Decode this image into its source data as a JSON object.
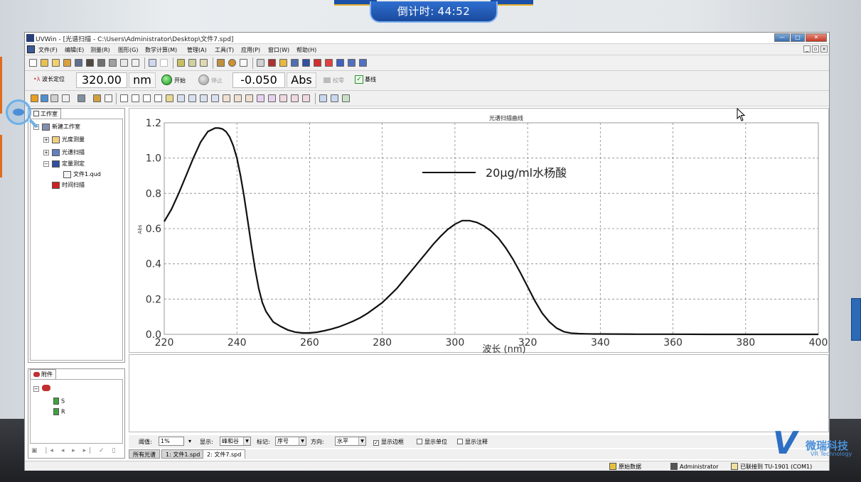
{
  "timer": {
    "label": "倒计时:",
    "value": "44:52"
  },
  "window": {
    "title": "UVWin - [光谱扫描 - C:\\Users\\Administrator\\Desktop\\文件7.spd]"
  },
  "menu": [
    "文件(F)",
    "编辑(E)",
    "测量(R)",
    "图形(G)",
    "数学计算(M)",
    "管理(A)",
    "工具(T)",
    "应用(P)",
    "窗口(W)",
    "帮助(H)"
  ],
  "measure_bar": {
    "wavelength_label": "波长定位",
    "wavelength_value": "320.00",
    "wavelength_unit": "nm",
    "start_label": "开始",
    "stop_label": "停止",
    "reading_value": "-0.050",
    "reading_unit": "Abs",
    "calibrate_label": "校零",
    "baseline_label": "基线"
  },
  "workspace": {
    "tab": "工作室",
    "tree": [
      {
        "label": "新建工作室",
        "level": 0,
        "icon": "workspace-icon"
      },
      {
        "label": "光度测量",
        "level": 1,
        "icon": "photometry-icon"
      },
      {
        "label": "光谱扫描",
        "level": 1,
        "icon": "spectrum-scan-icon"
      },
      {
        "label": "定量测定",
        "level": 1,
        "icon": "quantitative-icon"
      },
      {
        "label": "文件1.qud",
        "level": 2,
        "icon": "file-icon"
      },
      {
        "label": "时间扫描",
        "level": 1,
        "icon": "time-scan-icon"
      }
    ]
  },
  "attachments": {
    "tab": "附件",
    "items": [
      "S",
      "R"
    ]
  },
  "chart_data": {
    "type": "line",
    "title": "光谱扫描曲线",
    "xlabel": "波长 (nm)",
    "ylabel": "Abs",
    "xlim": [
      220,
      400
    ],
    "ylim": [
      0.0,
      1.2
    ],
    "xticks": [
      "220",
      "240",
      "260",
      "280",
      "300",
      "320",
      "340",
      "360",
      "380",
      "400"
    ],
    "yticks": [
      "0.0",
      "0.2",
      "0.4",
      "0.6",
      "0.8",
      "1.0",
      "1.2"
    ],
    "grid": true,
    "legend_position": "top-center",
    "series": [
      {
        "name": "20μg/ml水杨酸",
        "color": "#111111",
        "x": [
          220,
          222,
          224,
          226,
          228,
          230,
          232,
          234,
          235,
          236,
          237,
          238,
          239,
          240,
          241,
          242,
          243,
          244,
          245,
          246,
          247,
          248,
          249,
          250,
          252,
          254,
          256,
          258,
          260,
          262,
          264,
          266,
          268,
          270,
          272,
          274,
          276,
          278,
          280,
          282,
          284,
          286,
          288,
          290,
          292,
          294,
          296,
          298,
          300,
          302,
          304,
          306,
          308,
          310,
          312,
          314,
          316,
          318,
          320,
          322,
          324,
          326,
          328,
          330,
          332,
          334,
          336,
          338,
          340,
          350,
          360,
          370,
          380,
          390,
          400
        ],
        "y": [
          0.64,
          0.71,
          0.8,
          0.9,
          1.0,
          1.09,
          1.15,
          1.17,
          1.17,
          1.165,
          1.15,
          1.12,
          1.07,
          1.0,
          0.9,
          0.78,
          0.64,
          0.5,
          0.37,
          0.26,
          0.18,
          0.13,
          0.1,
          0.07,
          0.045,
          0.025,
          0.013,
          0.008,
          0.008,
          0.012,
          0.02,
          0.03,
          0.042,
          0.058,
          0.075,
          0.095,
          0.12,
          0.15,
          0.18,
          0.22,
          0.26,
          0.31,
          0.36,
          0.41,
          0.46,
          0.51,
          0.555,
          0.595,
          0.625,
          0.645,
          0.645,
          0.635,
          0.615,
          0.585,
          0.545,
          0.49,
          0.425,
          0.35,
          0.27,
          0.19,
          0.12,
          0.07,
          0.035,
          0.015,
          0.007,
          0.004,
          0.003,
          0.002,
          0.002,
          0.001,
          0.001,
          0.0,
          0.0,
          0.0,
          0.0
        ]
      }
    ]
  },
  "options": {
    "threshold_label": "阈值:",
    "threshold_value": "1%",
    "display_label": "显示:",
    "display_value": "峰和谷",
    "mark_label": "标记:",
    "mark_value": "序号",
    "direction_label": "方向:",
    "direction_value": "水平",
    "show_border": "显示边框",
    "show_unit": "显示单位",
    "show_note": "显示注释"
  },
  "doc_tabs": [
    "所有光谱",
    "1: 文件1.spd",
    "2: 文件7.spd"
  ],
  "status": {
    "raw_data": "原始数据",
    "user": "Administrator",
    "connection": "已联接到 TU-1901 (COM1)"
  },
  "brand": {
    "name": "微瑞科技",
    "sub": "VR Technology"
  }
}
